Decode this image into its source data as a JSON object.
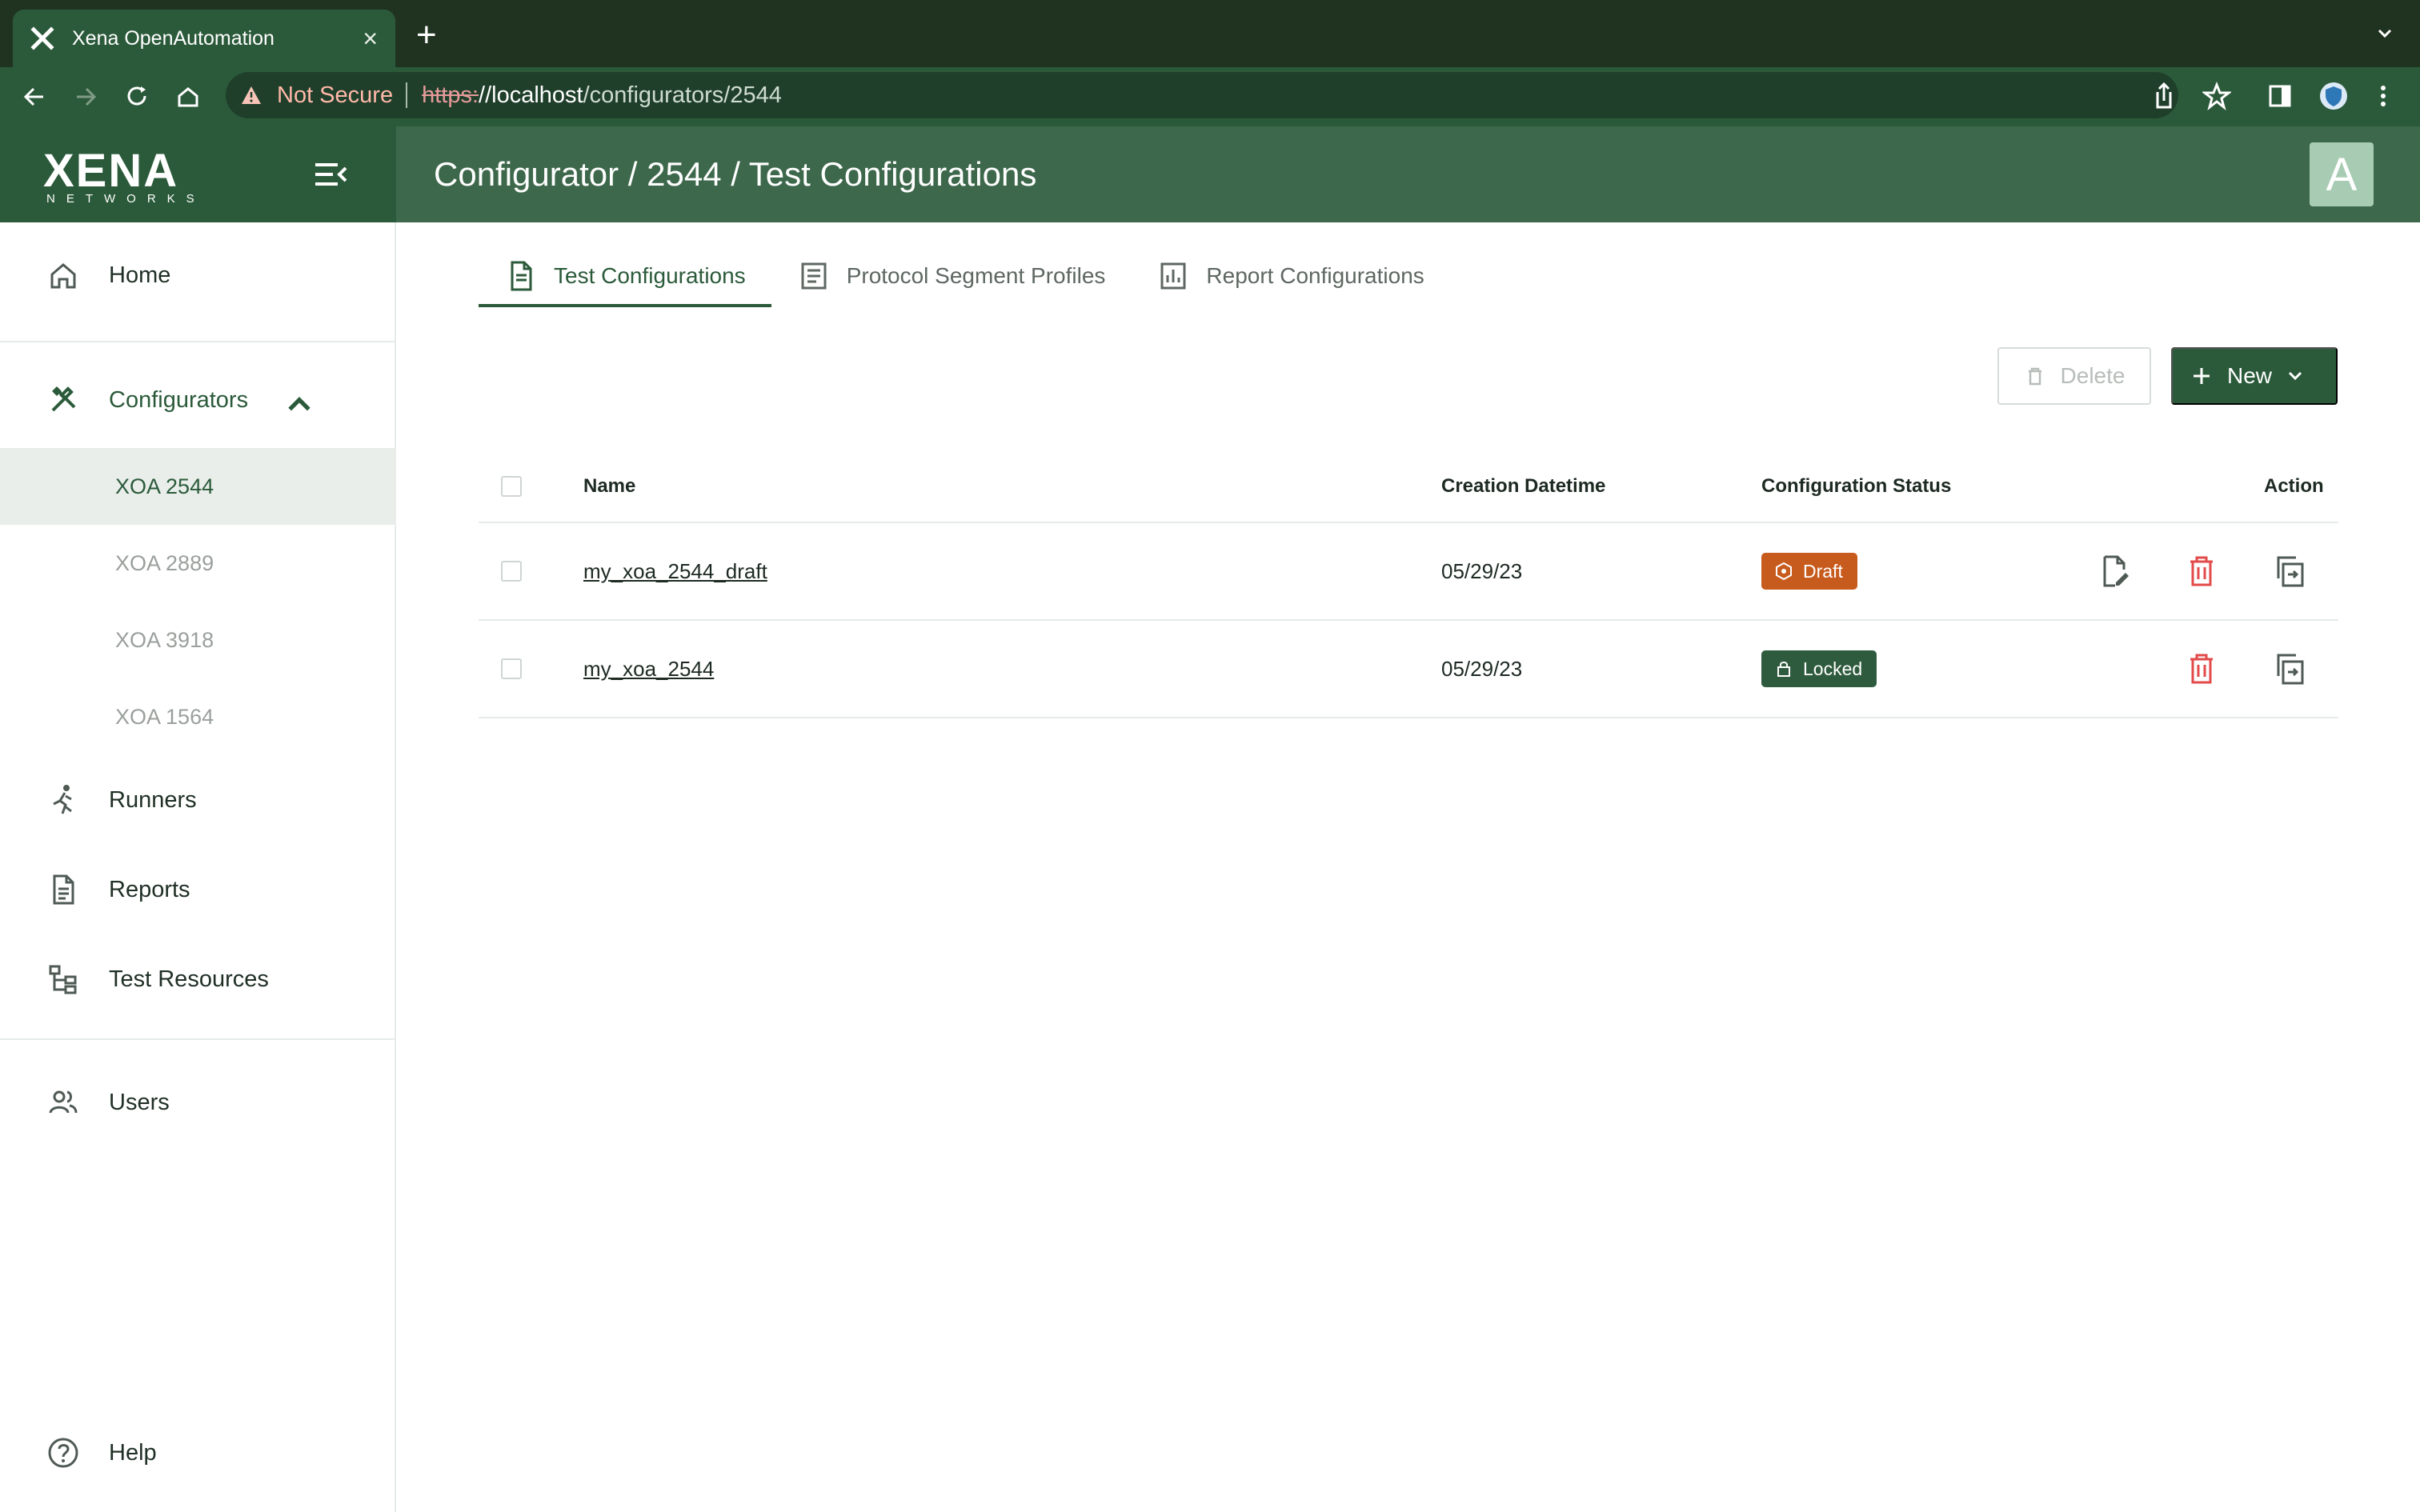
{
  "browser": {
    "tab_title": "Xena OpenAutomation",
    "tab_close": "×",
    "new_tab": "+",
    "not_secure": "Not Secure",
    "url_scheme": "https:",
    "url_host": "//localhost",
    "url_path": "/configurators/2544"
  },
  "app": {
    "logo_main": "XENA",
    "logo_sub": "NETWORKS",
    "title": "Configurator / 2544 / Test Configurations",
    "avatar": "A"
  },
  "sidebar": {
    "home": "Home",
    "configurators": "Configurators",
    "configurator_items": [
      "XOA 2544",
      "XOA 2889",
      "XOA 3918",
      "XOA 1564"
    ],
    "runners": "Runners",
    "reports": "Reports",
    "test_resources": "Test Resources",
    "users": "Users",
    "help": "Help"
  },
  "tabs": [
    {
      "label": "Test Configurations",
      "active": true,
      "icon": "document-icon"
    },
    {
      "label": "Protocol Segment Profiles",
      "active": false,
      "icon": "list-icon"
    },
    {
      "label": "Report Configurations",
      "active": false,
      "icon": "chart-icon"
    }
  ],
  "actions": {
    "delete": "Delete",
    "new": "New"
  },
  "table": {
    "columns": [
      "Name",
      "Creation Datetime",
      "Configuration Status",
      "Action"
    ],
    "rows": [
      {
        "name": "my_xoa_2544_draft",
        "created": "05/29/23",
        "status": "Draft",
        "status_color": "#c75a1d",
        "actions": [
          "edit-icon",
          "delete-icon",
          "copy-icon"
        ]
      },
      {
        "name": "my_xoa_2544",
        "created": "05/29/23",
        "status": "Locked",
        "status_color": "#2e5b3e",
        "actions": [
          "delete-icon",
          "copy-icon"
        ]
      }
    ]
  },
  "colors": {
    "primary": "#2b5a3a",
    "header": "#3d684b",
    "draft": "#c75a1d",
    "locked": "#2e5b3e",
    "danger": "#e34a4a"
  }
}
